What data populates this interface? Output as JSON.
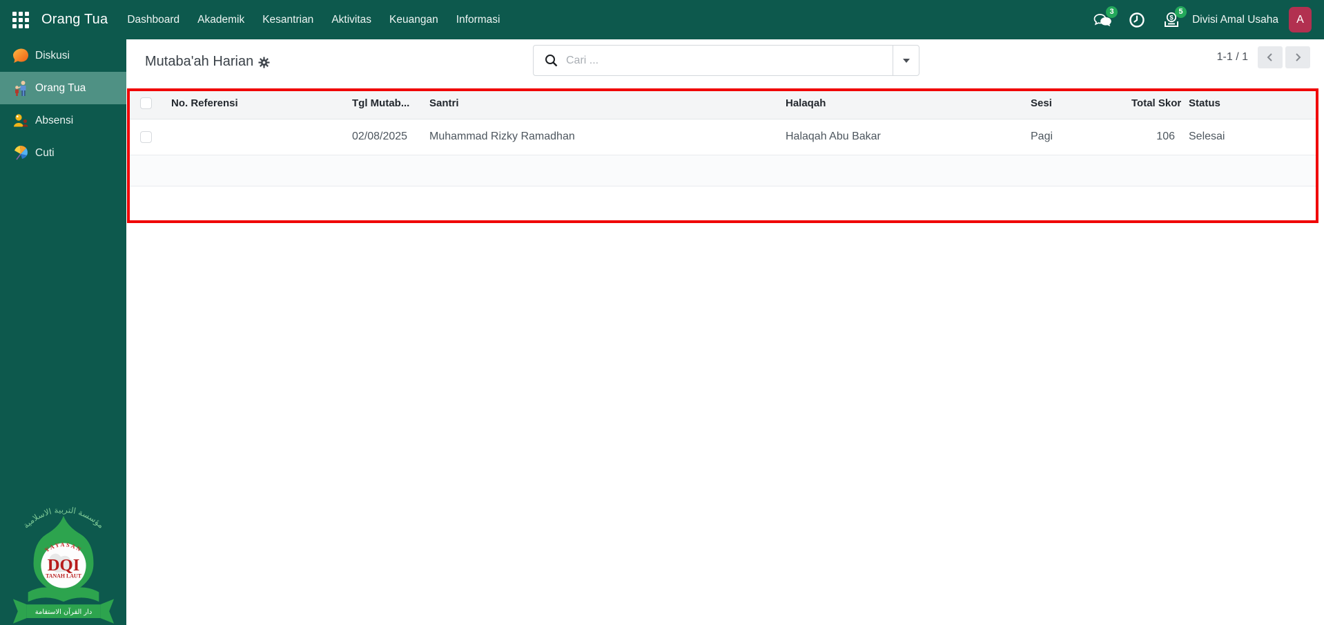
{
  "navbar": {
    "brand": "Orang Tua",
    "menu": [
      "Dashboard",
      "Akademik",
      "Kesantrian",
      "Aktivitas",
      "Keuangan",
      "Informasi"
    ],
    "messages_badge": "3",
    "activities_badge": "5",
    "user_company": "Divisi Amal Usaha",
    "avatar_letter": "A"
  },
  "sidebar": {
    "items": [
      {
        "label": "Diskusi"
      },
      {
        "label": "Orang Tua"
      },
      {
        "label": "Absensi"
      },
      {
        "label": "Cuti"
      }
    ],
    "active_item": "Orang Tua",
    "logo": {
      "arabic_top": "مؤسسة التربية الاسلامية",
      "org": "Y A Y A S A N",
      "acronym": "DQI",
      "region": "TANAH LAUT",
      "arabic_banner": "دار القرآن الاستقامة"
    }
  },
  "control_panel": {
    "title": "Mutaba'ah Harian",
    "search_placeholder": "Cari ...",
    "pager_text": "1-1 / 1"
  },
  "table": {
    "headers": [
      "No. Referensi",
      "Tgl Mutab...",
      "Santri",
      "Halaqah",
      "Sesi",
      "Total Skor",
      "Status"
    ],
    "rows": [
      {
        "no_referensi": "",
        "tgl_mutabaah": "02/08/2025",
        "santri": "Muhammad Rizky Ramadhan",
        "halaqah": "Halaqah Abu Bakar",
        "sesi": "Pagi",
        "total_skor": "106",
        "status": "Selesai"
      }
    ]
  },
  "colors": {
    "navbar_teal": "#0d594d",
    "active_item_teal": "#4f9184",
    "badge_green": "#23a85b",
    "avatar_red": "#b23050",
    "annotation_red": "#f00505",
    "header_bg": "#f4f5f6",
    "stripe_bg": "#fafbfc"
  }
}
